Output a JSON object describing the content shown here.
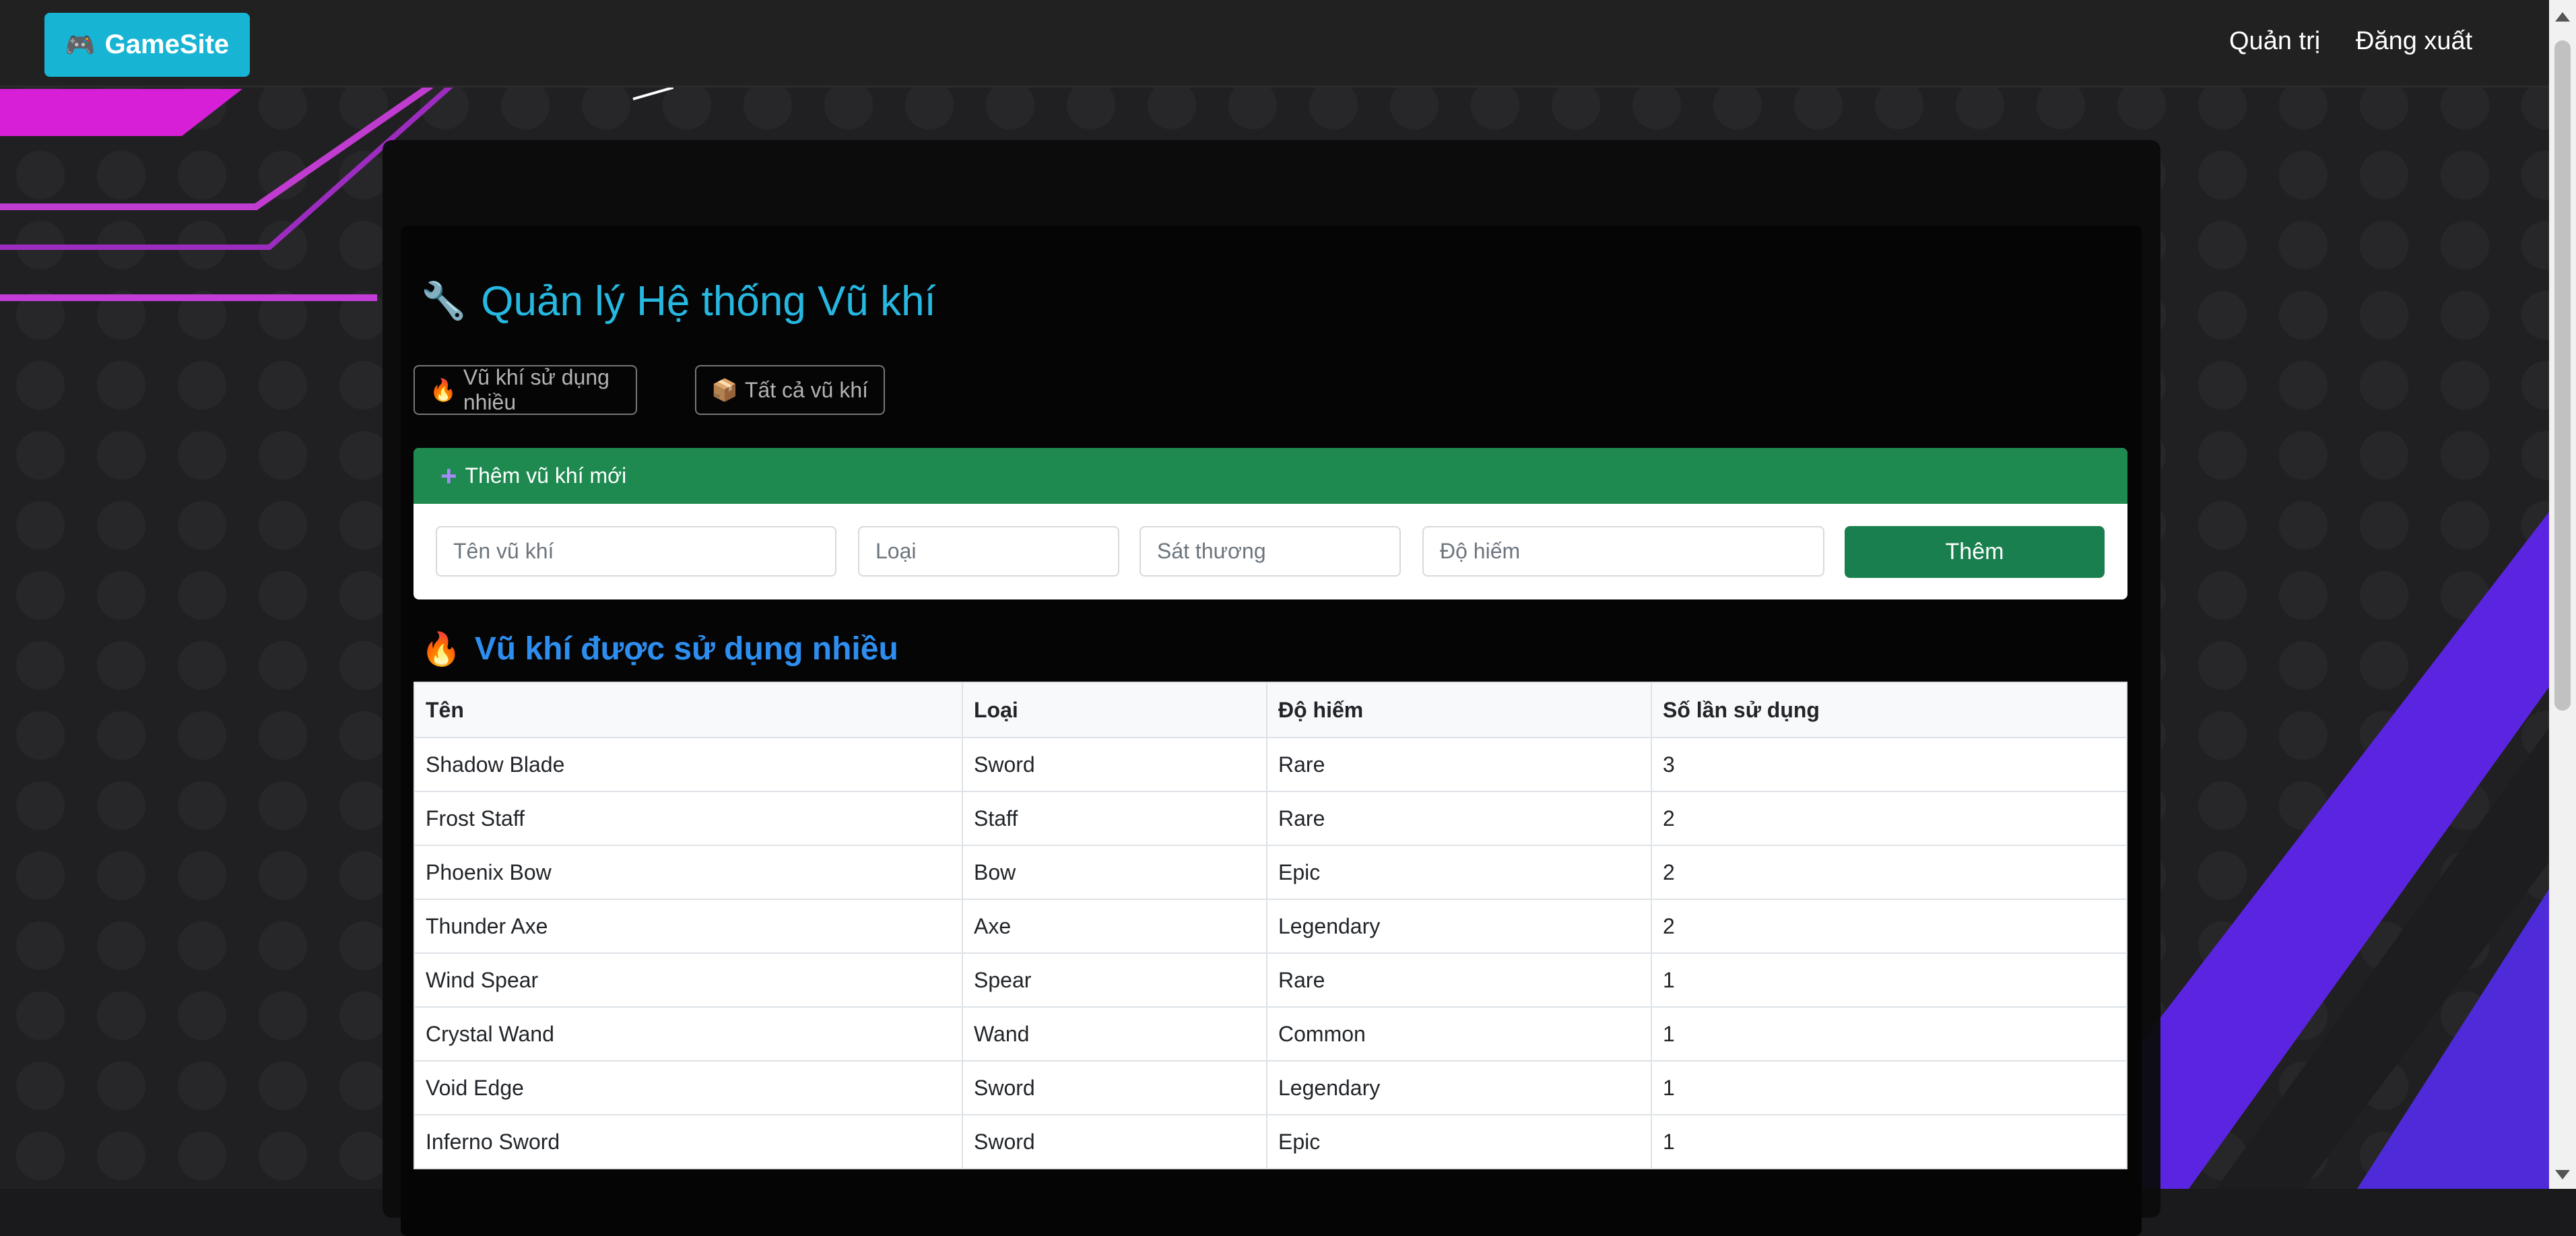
{
  "brand": {
    "icon": "gamepad-icon",
    "icon_glyph": "🎮",
    "name": "GameSite"
  },
  "nav": {
    "admin": "Quản trị",
    "logout": "Đăng xuất"
  },
  "page": {
    "title_icon": "🔧",
    "title": "Quản lý Hệ thống Vũ khí"
  },
  "tabs": [
    {
      "icon": "🔥",
      "label": "Vũ khí sử dụng nhiều"
    },
    {
      "icon": "📦",
      "label": "Tất cả vũ khí"
    }
  ],
  "add_form": {
    "header": "Thêm vũ khí mới",
    "name_placeholder": "Tên vũ khí",
    "type_placeholder": "Loại",
    "damage_placeholder": "Sát thương",
    "rarity_placeholder": "Độ hiếm",
    "submit_label": "Thêm"
  },
  "popular": {
    "icon": "🔥",
    "title": "Vũ khí được sử dụng nhiều",
    "columns": [
      "Tên",
      "Loại",
      "Độ hiếm",
      "Số lần sử dụng"
    ],
    "rows": [
      [
        "Shadow Blade",
        "Sword",
        "Rare",
        "3"
      ],
      [
        "Frost Staff",
        "Staff",
        "Rare",
        "2"
      ],
      [
        "Phoenix Bow",
        "Bow",
        "Epic",
        "2"
      ],
      [
        "Thunder Axe",
        "Axe",
        "Legendary",
        "2"
      ],
      [
        "Wind Spear",
        "Spear",
        "Rare",
        "1"
      ],
      [
        "Crystal Wand",
        "Wand",
        "Common",
        "1"
      ],
      [
        "Void Edge",
        "Sword",
        "Legendary",
        "1"
      ],
      [
        "Inferno Sword",
        "Sword",
        "Epic",
        "1"
      ]
    ]
  },
  "colors": {
    "brand": "#17b4d4",
    "title": "#26b8e0",
    "success": "#1e8a50",
    "section": "#2d8ef0"
  }
}
